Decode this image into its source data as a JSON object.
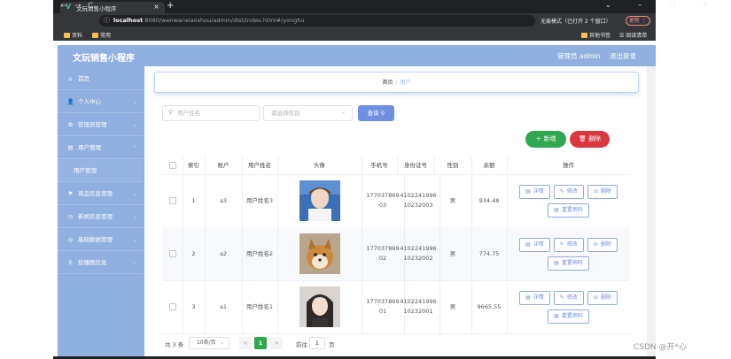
{
  "browser": {
    "tab_title": "文玩销售小程序",
    "tab_close": "×",
    "new_tab": "+",
    "window_controls": "⌄ – ❐ ✕",
    "nav": {
      "back": "←",
      "forward": "→",
      "reload": "C"
    },
    "url_host": "localhost",
    "url_rest": ":8080/wenwanxiaoshou/admin/dist/index.html#/yonghu",
    "incognito_label": "无痕模式（已打开 2 个窗口）",
    "update_label": "更新 ⋮",
    "bookmarks": [
      "资料",
      "常用"
    ],
    "bookmarks_right": [
      "其他书签",
      "阅读清单"
    ]
  },
  "app": {
    "title": "文玩销售小程序",
    "admin_label": "管理员 admin",
    "logout_label": "退出登录"
  },
  "sidebar": {
    "items": [
      {
        "label": "首页",
        "icon": "home-icon",
        "glyph": "⌂"
      },
      {
        "label": "个人中心",
        "icon": "user-icon",
        "glyph": "👤"
      },
      {
        "label": "管理员管理",
        "icon": "admin-icon",
        "glyph": "⚙"
      },
      {
        "label": "用户管理",
        "icon": "users-icon",
        "glyph": "▤"
      },
      {
        "label": "用户管理",
        "icon": "",
        "glyph": ""
      },
      {
        "label": "商品信息管理",
        "icon": "flag-icon",
        "glyph": "⚑"
      },
      {
        "label": "新闻信息管理",
        "icon": "news-icon",
        "glyph": "◷"
      },
      {
        "label": "基础数据管理",
        "icon": "data-icon",
        "glyph": "◎"
      },
      {
        "label": "轮播图信息",
        "icon": "location-icon",
        "glyph": "⚲"
      }
    ]
  },
  "breadcrumb": {
    "home": "首页",
    "separator": "/",
    "current": "用户"
  },
  "search": {
    "name_placeholder": "用户姓名",
    "gender_placeholder": "请选择性别",
    "query_label": "查询"
  },
  "actions": {
    "add_label": "新增",
    "delete_label": "删除"
  },
  "table": {
    "columns": [
      "",
      "索引",
      "账户",
      "用户姓名",
      "头像",
      "手机号",
      "身份证号",
      "性别",
      "余额",
      "操作"
    ],
    "rows": [
      {
        "index": "1",
        "account": "a3",
        "name": "用户姓名3",
        "phone": "17703786903",
        "idcard": "410224199610232003",
        "gender": "男",
        "balance": "934.48",
        "avatar_color": "#3b6fb6"
      },
      {
        "index": "2",
        "account": "a2",
        "name": "用户姓名2",
        "phone": "17703786902",
        "idcard": "410224199610232002",
        "gender": "男",
        "balance": "774.75",
        "avatar_color": "#c98a3e"
      },
      {
        "index": "3",
        "account": "a1",
        "name": "用户姓名1",
        "phone": "17703786901",
        "idcard": "410224199610232001",
        "gender": "男",
        "balance": "9665.55",
        "avatar_color": "#2e2a2a"
      }
    ],
    "ops": {
      "detail": "详情",
      "edit": "修改",
      "delete": "删除",
      "reset": "重置密码"
    }
  },
  "pagination": {
    "total": "共 3 条",
    "page_size": "10条/页",
    "prev": "<",
    "current": "1",
    "next": ">",
    "goto": "前往",
    "jump_value": "1",
    "page_suffix": "页"
  },
  "watermark": "CSDN @开*心"
}
